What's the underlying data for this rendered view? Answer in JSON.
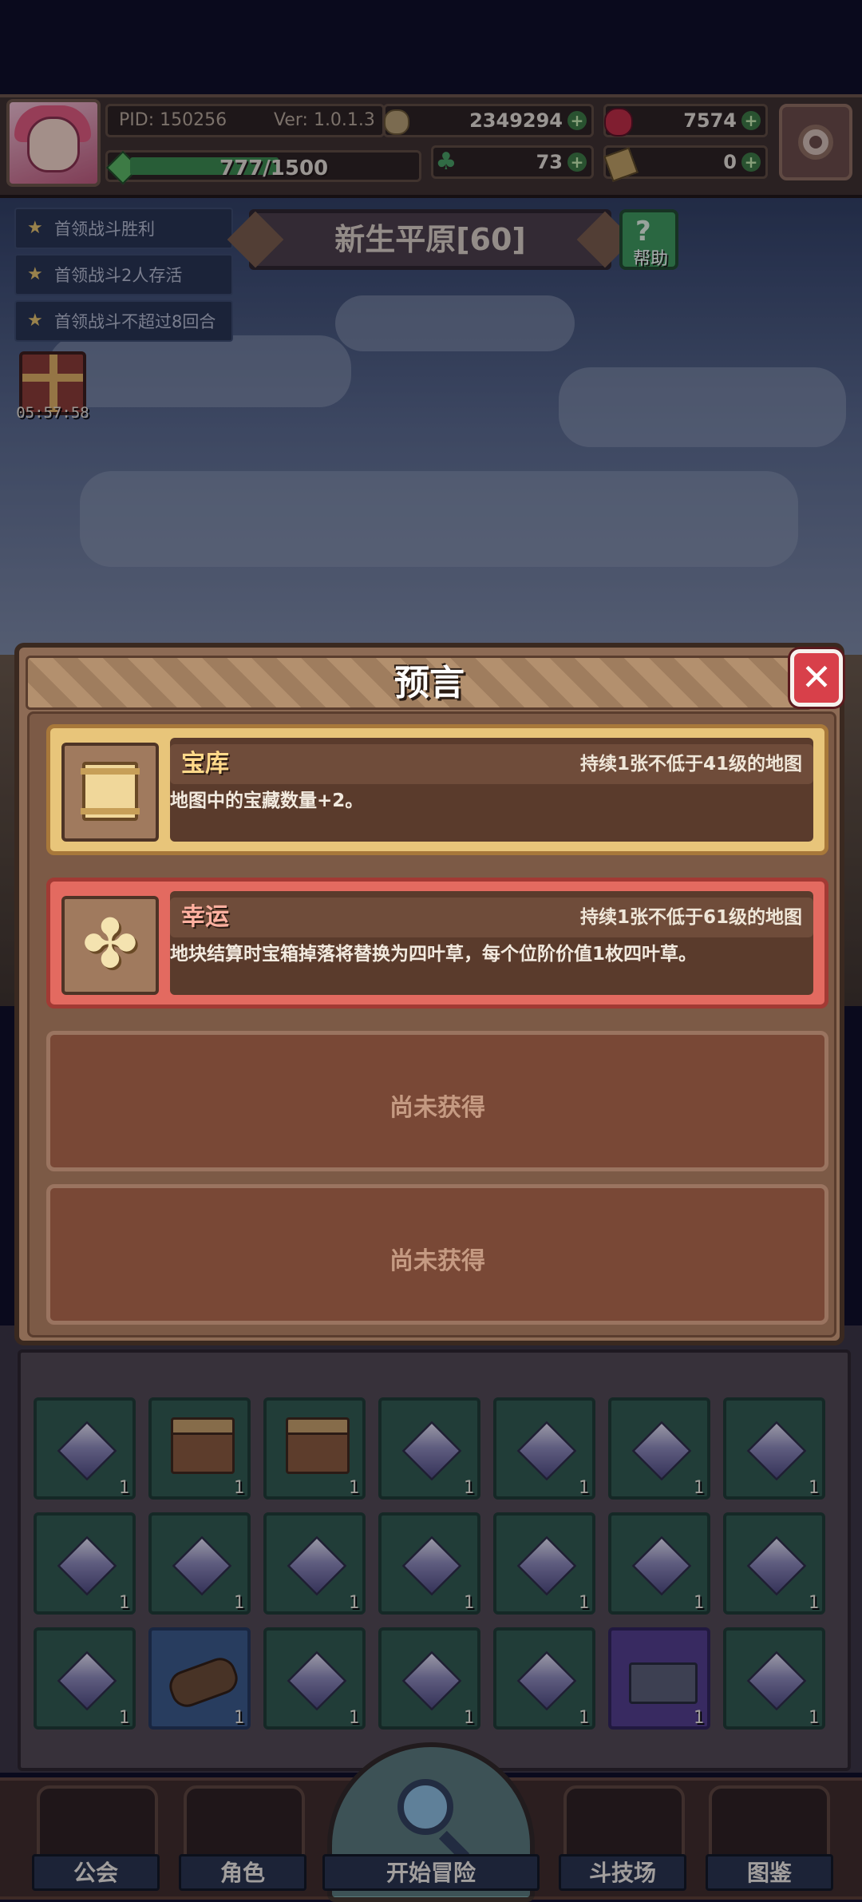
{
  "hud": {
    "pid": "PID: 150256",
    "version": "Ver: 1.0.1.3",
    "gold": "2349294",
    "berries": "7574",
    "xp": "777/1500",
    "xp_progress": 0.518,
    "clovers": "73",
    "tickets": "0",
    "plus": "+"
  },
  "quests": [
    {
      "label": "首领战斗胜利"
    },
    {
      "label": "首领战斗2人存活"
    },
    {
      "label": "首领战斗不超过8回合"
    }
  ],
  "stage": {
    "title": "新生平原[60]",
    "help_label": "帮助",
    "help_glyph": "?"
  },
  "gift": {
    "timer": "05:57:58"
  },
  "modal": {
    "title": "预言",
    "close_glyph": "✕",
    "cards": [
      {
        "name": "宝库",
        "duration": "持续1张不低于41级的地图",
        "description": "地图中的宝藏数量+2。",
        "icon": "scroll-icon"
      },
      {
        "name": "幸运",
        "duration": "持续1张不低于61级的地图",
        "description": "地块结算时宝箱掉落将替换为四叶草，每个位阶价值1枚四叶草。",
        "icon": "four-leaf-clover-icon"
      }
    ],
    "empty_slots": [
      {
        "label": "尚未获得"
      },
      {
        "label": "尚未获得"
      }
    ]
  },
  "inventory": {
    "count_label": "1",
    "rows": [
      [
        "gem",
        "chest",
        "chest",
        "gem",
        "gem",
        "gem",
        "gem"
      ],
      [
        "gem",
        "gem",
        "gem",
        "gem",
        "gem",
        "gem",
        "gem"
      ],
      [
        "gem",
        "log",
        "gem",
        "gem",
        "gem",
        "box",
        "gem"
      ]
    ]
  },
  "nav": {
    "items": [
      {
        "label": "公会"
      },
      {
        "label": "角色"
      },
      {
        "label": "开始冒险"
      },
      {
        "label": "斗技场"
      },
      {
        "label": "图鉴"
      }
    ]
  },
  "colors": {
    "modal_bg": "#8d6b55",
    "card_gold": "#e8c57a",
    "card_red": "#e36a60",
    "close_red": "#d8404a"
  }
}
